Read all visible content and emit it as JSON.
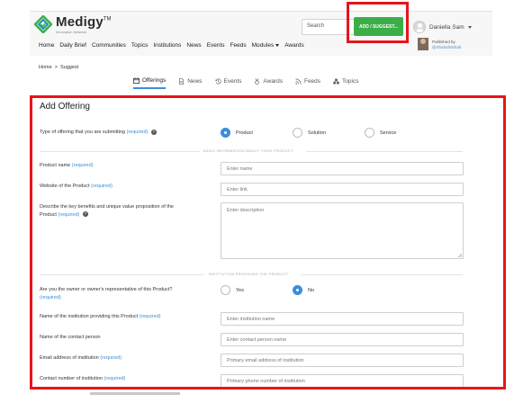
{
  "header": {
    "logo": {
      "name": "Medigy",
      "tm": "TM",
      "tagline": "Innovation Network"
    },
    "search": {
      "placeholder": "Search"
    },
    "suggest_button": "ADD / SUGGEST...",
    "user": {
      "name": "Daniella Sam"
    },
    "nav": [
      "Home",
      "Daily Brief",
      "Communities",
      "Topics",
      "Institutions",
      "News",
      "Events",
      "Feeds",
      "Modules",
      "Awards"
    ],
    "published": {
      "label": "Published by",
      "handle": "@ShahidNShah"
    }
  },
  "breadcrumb": {
    "home": "Home",
    "sep": ">",
    "current": "Suggest"
  },
  "tabs": [
    {
      "label": "Offerings",
      "icon": "calendar-icon",
      "active": true
    },
    {
      "label": "News",
      "icon": "document-icon",
      "active": false
    },
    {
      "label": "Events",
      "icon": "history-icon",
      "active": false
    },
    {
      "label": "Awards",
      "icon": "award-icon",
      "active": false
    },
    {
      "label": "Feeds",
      "icon": "rss-icon",
      "active": false
    },
    {
      "label": "Topics",
      "icon": "topics-icon",
      "active": false
    }
  ],
  "form": {
    "title": "Add Offering",
    "required": "(required)",
    "type_label": "Type of offering that you are submitting",
    "type_options": [
      "Product",
      "Solution",
      "Service"
    ],
    "type_selected": "Product",
    "section_basic": "BASIC INFORMATION ABOUT YOUR PRODUCT",
    "product_name": {
      "label": "Product name",
      "placeholder": "Enter name"
    },
    "website": {
      "label": "Website of the Product",
      "placeholder": "Enter link"
    },
    "description": {
      "label": "Describe the key benefits and unique value proposition of the",
      "label2": "Product",
      "placeholder": "Enter description"
    },
    "section_institution": "INSTITUTION PROVIDING THE PRODUCT",
    "owner_question": "Are you the owner or owner's representative of this Product?",
    "owner_options": [
      "Yes",
      "No"
    ],
    "owner_selected": "No",
    "institution_name": {
      "label": "Name of the institution providing this Product",
      "placeholder": "Enter institution name"
    },
    "contact_person": {
      "label": "Name of the contact person",
      "placeholder": "Enter contact person name"
    },
    "email": {
      "label": "Email address of institution",
      "placeholder": "Primary email address of institution"
    },
    "phone": {
      "label": "Contact number of institution",
      "placeholder": "Primary phone number of institution"
    }
  },
  "colors": {
    "accent": "#3b8ddc",
    "suggest": "#3cae48",
    "highlight": "#e8141b"
  }
}
